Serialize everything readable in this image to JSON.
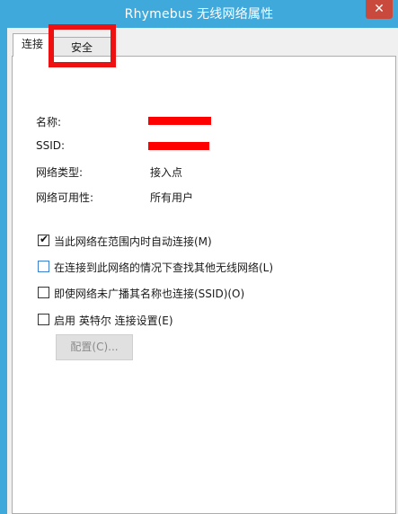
{
  "window": {
    "title": "Rhymebus 无线网络属性",
    "close_label": "✕"
  },
  "tabs": [
    {
      "label": "连接",
      "active": true
    },
    {
      "label": "安全",
      "active": false
    }
  ],
  "info": {
    "name_label": "名称:",
    "ssid_label": "SSID:",
    "type_label": "网络类型:",
    "type_value": "接入点",
    "avail_label": "网络可用性:",
    "avail_value": "所有用户"
  },
  "options": [
    {
      "label": "当此网络在范围内时自动连接(M)",
      "checked": true
    },
    {
      "label": "在连接到此网络的情况下查找其他无线网络(L)",
      "checked": false
    },
    {
      "label": "即使网络未广播其名称也连接(SSID)(O)",
      "checked": false
    },
    {
      "label": "启用 英特尔 连接设置(E)",
      "checked": false
    }
  ],
  "config_button": "配置(C)...",
  "colors": {
    "frame": "#3fa9dc",
    "highlight": "#ee1111",
    "redaction": "#ff0000"
  }
}
